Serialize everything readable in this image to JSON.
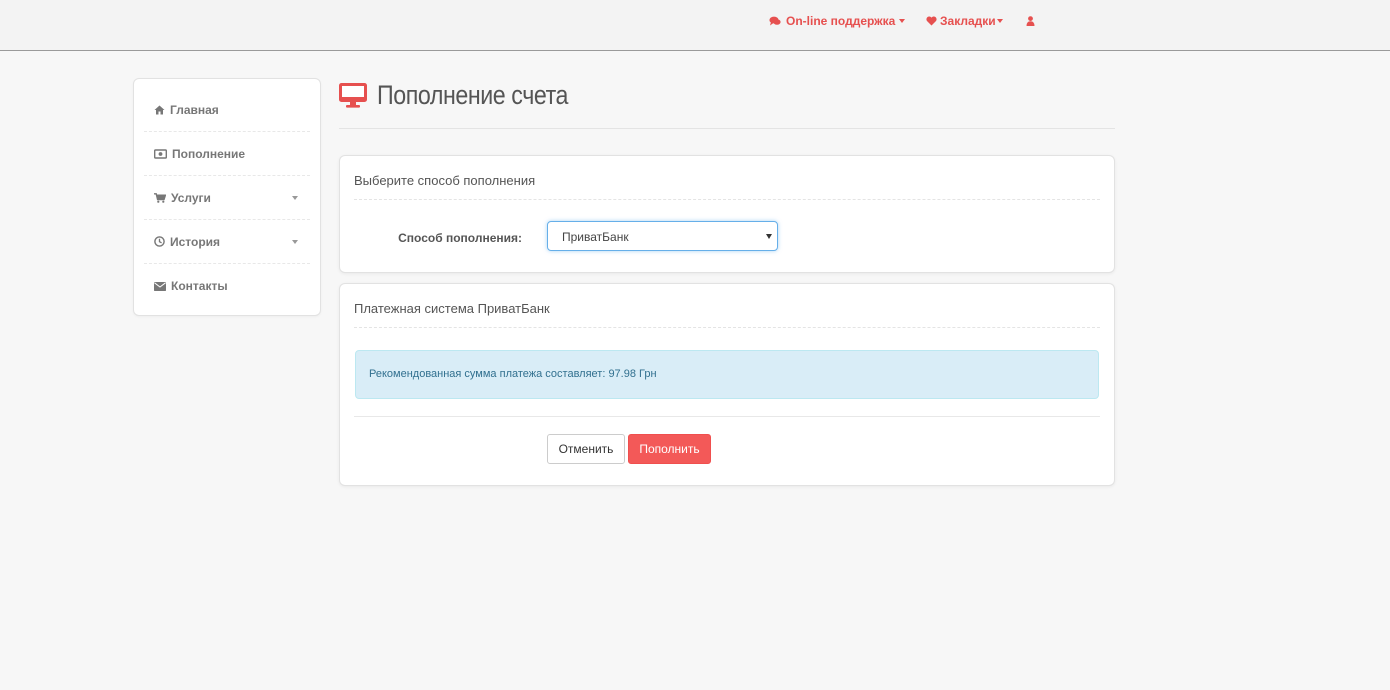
{
  "navbar": {
    "support_label": "On-line поддержка",
    "bookmarks_label": "Закладки"
  },
  "sidebar": {
    "items": [
      {
        "label": "Главная",
        "icon": "home-icon"
      },
      {
        "label": "Пополнение",
        "icon": "money-icon"
      },
      {
        "label": "Услуги",
        "icon": "cart-icon"
      },
      {
        "label": "История",
        "icon": "clock-icon"
      },
      {
        "label": "Контакты",
        "icon": "envelope-icon"
      }
    ]
  },
  "page": {
    "title": "Пополнение счета",
    "icon": "monitor-icon"
  },
  "method_panel": {
    "heading": "Выберите способ пополнения",
    "field_label": "Способ пополнения:",
    "selected_value": "ПриватБанк"
  },
  "payment_panel": {
    "heading": "Платежная система ПриватБанк",
    "info_text": "Рекомендованная сумма платежа составляет: 97.98 Грн",
    "cancel_label": "Отменить",
    "submit_label": "Пополнить"
  },
  "colors": {
    "accent": "#e6504f",
    "submit": "#f35958",
    "info_bg": "#d9edf7",
    "info_text": "#31708f"
  }
}
